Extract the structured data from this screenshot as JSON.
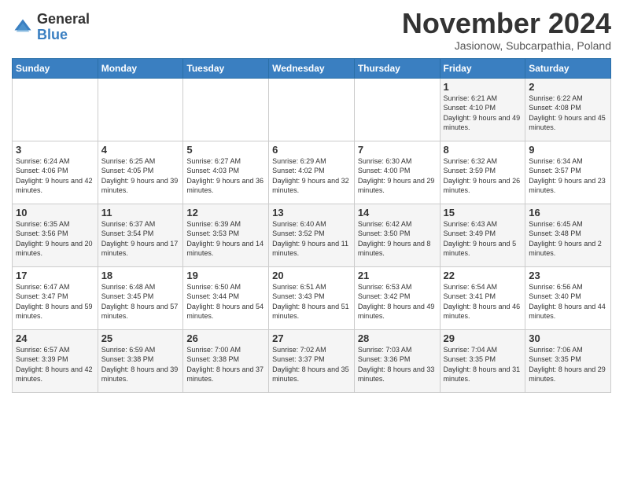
{
  "header": {
    "logo_line1": "General",
    "logo_line2": "Blue",
    "month": "November 2024",
    "location": "Jasionow, Subcarpathia, Poland"
  },
  "days_of_week": [
    "Sunday",
    "Monday",
    "Tuesday",
    "Wednesday",
    "Thursday",
    "Friday",
    "Saturday"
  ],
  "weeks": [
    [
      {
        "day": "",
        "info": ""
      },
      {
        "day": "",
        "info": ""
      },
      {
        "day": "",
        "info": ""
      },
      {
        "day": "",
        "info": ""
      },
      {
        "day": "",
        "info": ""
      },
      {
        "day": "1",
        "info": "Sunrise: 6:21 AM\nSunset: 4:10 PM\nDaylight: 9 hours and 49 minutes."
      },
      {
        "day": "2",
        "info": "Sunrise: 6:22 AM\nSunset: 4:08 PM\nDaylight: 9 hours and 45 minutes."
      }
    ],
    [
      {
        "day": "3",
        "info": "Sunrise: 6:24 AM\nSunset: 4:06 PM\nDaylight: 9 hours and 42 minutes."
      },
      {
        "day": "4",
        "info": "Sunrise: 6:25 AM\nSunset: 4:05 PM\nDaylight: 9 hours and 39 minutes."
      },
      {
        "day": "5",
        "info": "Sunrise: 6:27 AM\nSunset: 4:03 PM\nDaylight: 9 hours and 36 minutes."
      },
      {
        "day": "6",
        "info": "Sunrise: 6:29 AM\nSunset: 4:02 PM\nDaylight: 9 hours and 32 minutes."
      },
      {
        "day": "7",
        "info": "Sunrise: 6:30 AM\nSunset: 4:00 PM\nDaylight: 9 hours and 29 minutes."
      },
      {
        "day": "8",
        "info": "Sunrise: 6:32 AM\nSunset: 3:59 PM\nDaylight: 9 hours and 26 minutes."
      },
      {
        "day": "9",
        "info": "Sunrise: 6:34 AM\nSunset: 3:57 PM\nDaylight: 9 hours and 23 minutes."
      }
    ],
    [
      {
        "day": "10",
        "info": "Sunrise: 6:35 AM\nSunset: 3:56 PM\nDaylight: 9 hours and 20 minutes."
      },
      {
        "day": "11",
        "info": "Sunrise: 6:37 AM\nSunset: 3:54 PM\nDaylight: 9 hours and 17 minutes."
      },
      {
        "day": "12",
        "info": "Sunrise: 6:39 AM\nSunset: 3:53 PM\nDaylight: 9 hours and 14 minutes."
      },
      {
        "day": "13",
        "info": "Sunrise: 6:40 AM\nSunset: 3:52 PM\nDaylight: 9 hours and 11 minutes."
      },
      {
        "day": "14",
        "info": "Sunrise: 6:42 AM\nSunset: 3:50 PM\nDaylight: 9 hours and 8 minutes."
      },
      {
        "day": "15",
        "info": "Sunrise: 6:43 AM\nSunset: 3:49 PM\nDaylight: 9 hours and 5 minutes."
      },
      {
        "day": "16",
        "info": "Sunrise: 6:45 AM\nSunset: 3:48 PM\nDaylight: 9 hours and 2 minutes."
      }
    ],
    [
      {
        "day": "17",
        "info": "Sunrise: 6:47 AM\nSunset: 3:47 PM\nDaylight: 8 hours and 59 minutes."
      },
      {
        "day": "18",
        "info": "Sunrise: 6:48 AM\nSunset: 3:45 PM\nDaylight: 8 hours and 57 minutes."
      },
      {
        "day": "19",
        "info": "Sunrise: 6:50 AM\nSunset: 3:44 PM\nDaylight: 8 hours and 54 minutes."
      },
      {
        "day": "20",
        "info": "Sunrise: 6:51 AM\nSunset: 3:43 PM\nDaylight: 8 hours and 51 minutes."
      },
      {
        "day": "21",
        "info": "Sunrise: 6:53 AM\nSunset: 3:42 PM\nDaylight: 8 hours and 49 minutes."
      },
      {
        "day": "22",
        "info": "Sunrise: 6:54 AM\nSunset: 3:41 PM\nDaylight: 8 hours and 46 minutes."
      },
      {
        "day": "23",
        "info": "Sunrise: 6:56 AM\nSunset: 3:40 PM\nDaylight: 8 hours and 44 minutes."
      }
    ],
    [
      {
        "day": "24",
        "info": "Sunrise: 6:57 AM\nSunset: 3:39 PM\nDaylight: 8 hours and 42 minutes."
      },
      {
        "day": "25",
        "info": "Sunrise: 6:59 AM\nSunset: 3:38 PM\nDaylight: 8 hours and 39 minutes."
      },
      {
        "day": "26",
        "info": "Sunrise: 7:00 AM\nSunset: 3:38 PM\nDaylight: 8 hours and 37 minutes."
      },
      {
        "day": "27",
        "info": "Sunrise: 7:02 AM\nSunset: 3:37 PM\nDaylight: 8 hours and 35 minutes."
      },
      {
        "day": "28",
        "info": "Sunrise: 7:03 AM\nSunset: 3:36 PM\nDaylight: 8 hours and 33 minutes."
      },
      {
        "day": "29",
        "info": "Sunrise: 7:04 AM\nSunset: 3:35 PM\nDaylight: 8 hours and 31 minutes."
      },
      {
        "day": "30",
        "info": "Sunrise: 7:06 AM\nSunset: 3:35 PM\nDaylight: 8 hours and 29 minutes."
      }
    ]
  ]
}
